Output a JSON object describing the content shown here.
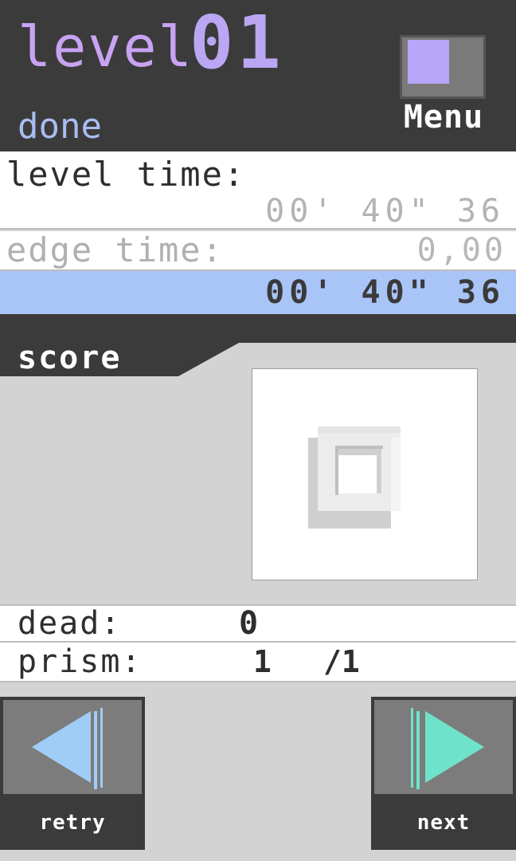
{
  "header": {
    "level_label": "level",
    "level_number": "01",
    "status": "done",
    "menu_label": "Menu"
  },
  "times": {
    "level_time_label": "level time:",
    "level_time_value": "00' 40\" 36",
    "edge_time_label": "edge time:",
    "edge_time_value": "0,00",
    "total_time_value": "00' 40\" 36"
  },
  "score": {
    "label": "score"
  },
  "stats": {
    "dead_label": "dead:",
    "dead_value": "0",
    "prism_label": "prism:",
    "prism_value": "1",
    "prism_total": "/1"
  },
  "nav": {
    "retry_label": "retry",
    "next_label": "next"
  },
  "colors": {
    "dark": "#3b3b3b",
    "level_purple": "#c9a3f3",
    "done_blue": "#a9bdf0",
    "highlight_row": "#a9c4f7",
    "retry_arrow": "#9fcdf7",
    "next_arrow": "#6ee3c9",
    "menu_square": "#b8a6f8"
  },
  "icons": {
    "menu": "square-icon",
    "score_rank": "square-frame-icon",
    "retry": "rewind-arrow-icon",
    "next": "play-arrow-icon"
  }
}
